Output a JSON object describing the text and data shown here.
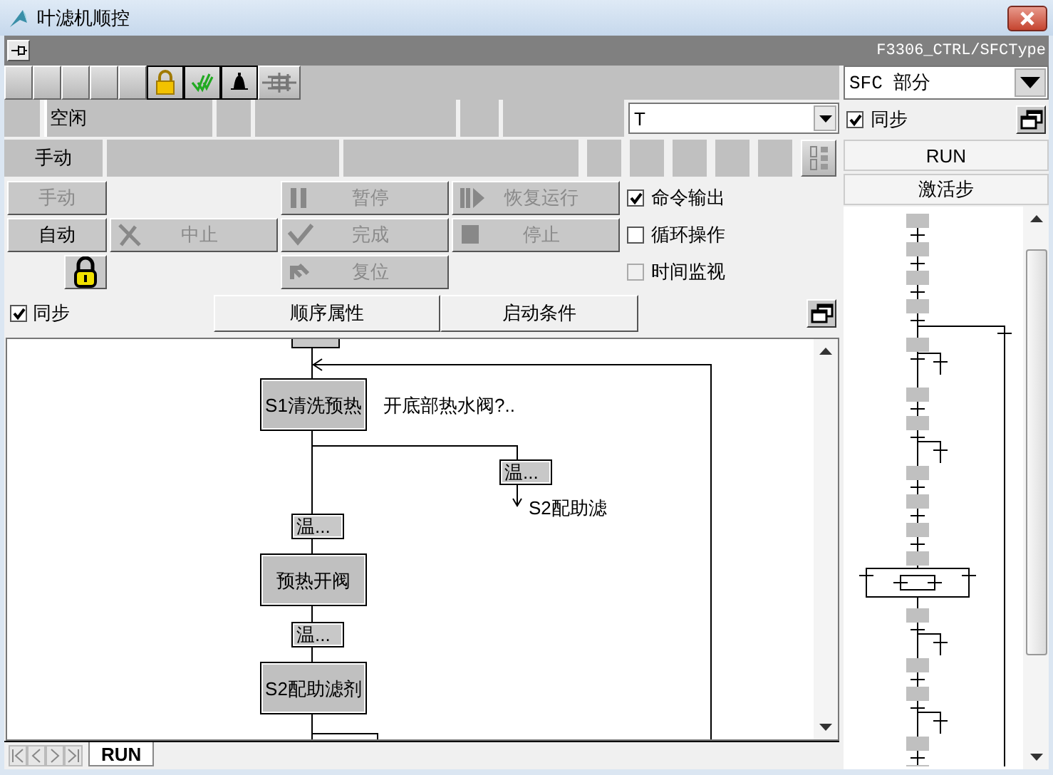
{
  "window": {
    "title": "叶滤机顺控",
    "path": "F3306_CTRL/SFCType"
  },
  "toolbar": [
    {
      "kind": "blank"
    },
    {
      "kind": "blank"
    },
    {
      "kind": "blank"
    },
    {
      "kind": "blank"
    },
    {
      "kind": "blank"
    },
    {
      "kind": "lock"
    },
    {
      "kind": "check"
    },
    {
      "kind": "bell"
    },
    {
      "kind": "tool"
    }
  ],
  "status": {
    "state": "空闲",
    "step_filter": "T",
    "mode": "手动"
  },
  "mode_buttons": [
    {
      "label": "手动",
      "disabled": true
    },
    {
      "label": "自动",
      "disabled": false
    }
  ],
  "commands": [
    {
      "kind": "pause",
      "label": "暂停",
      "disabled": true
    },
    {
      "kind": "resume",
      "label": "恢复运行",
      "disabled": true
    },
    {
      "kind": "abort",
      "label": "中止",
      "disabled": true
    },
    {
      "kind": "complete",
      "label": "完成",
      "disabled": true
    },
    {
      "kind": "stop",
      "label": "停止",
      "disabled": true
    },
    {
      "kind": "reset",
      "label": "复位",
      "disabled": true
    }
  ],
  "options": [
    {
      "label": "命令输出",
      "checked": true,
      "disabled": false
    },
    {
      "label": "循环操作",
      "checked": false,
      "disabled": false
    },
    {
      "label": "时间监视",
      "checked": false,
      "disabled": true
    }
  ],
  "sync": {
    "label": "同步",
    "checked": true
  },
  "panel_buttons": [
    "顺序属性",
    "启动条件"
  ],
  "sfc": [
    {
      "kind": "step",
      "name": "S1清洗预热",
      "action": "开底部热水阀?..",
      "branch": {
        "label": "温...",
        "target": "S2配助滤"
      }
    },
    {
      "kind": "transition",
      "label": "温..."
    },
    {
      "kind": "step",
      "name": "预热开阀"
    },
    {
      "kind": "transition",
      "label": "温..."
    },
    {
      "kind": "step",
      "name": "S2配助滤剂"
    }
  ],
  "sheet_tabs": [
    {
      "label": "RUN",
      "selected": true
    }
  ],
  "side_panel": {
    "dropdown": "SFC 部分",
    "sync": {
      "label": "同步",
      "checked": true
    },
    "title": "RUN",
    "subtitle": "激活步"
  }
}
